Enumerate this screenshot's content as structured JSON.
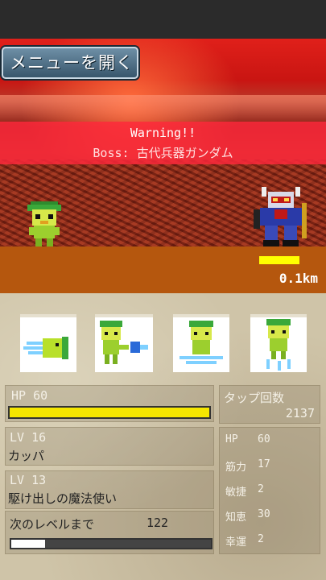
{
  "menu": {
    "open_label": "メニューを開く"
  },
  "battle": {
    "warning": "Warning!!",
    "boss_label": "Boss: 古代兵器ガンダム",
    "boss_hp_fraction": 1.0,
    "distance": "0.1km"
  },
  "skills": [
    {
      "name": "dash-skill-icon"
    },
    {
      "name": "punch-skill-icon"
    },
    {
      "name": "levitate-skill-icon"
    },
    {
      "name": "jump-skill-icon"
    }
  ],
  "status": {
    "hp_label": "HP 60",
    "hp_fraction": 1.0,
    "level1_label": "LV   16",
    "class1": "カッパ",
    "level2_label": "LV  13",
    "class2": "駆け出しの魔法使い",
    "next_level_label": "次のレベルまで",
    "next_level_value": "122",
    "xp_fraction": 0.17
  },
  "taps": {
    "label": "タップ回数",
    "value": "2137"
  },
  "stats": [
    {
      "name": "HP",
      "value": "60"
    },
    {
      "name": "筋力",
      "value": "17"
    },
    {
      "name": "敏捷",
      "value": "2"
    },
    {
      "name": "知恵",
      "value": "30"
    },
    {
      "name": "幸運",
      "value": "2"
    }
  ],
  "colors": {
    "boss_hp": "#ffff00",
    "hp_bar": "#f5e600",
    "warning_bg": "#ff283c",
    "progress_bg": "#b5570e"
  }
}
